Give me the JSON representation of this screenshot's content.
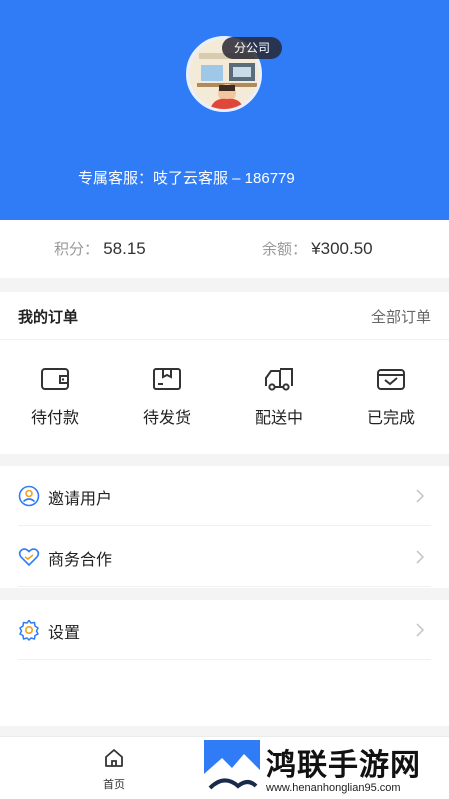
{
  "header": {
    "badge": "分公司",
    "service_text": "专属客服：吱了云客服 – 186779"
  },
  "stats": {
    "points_label": "积分：",
    "points_value": "58.15",
    "balance_label": "余额：",
    "balance_value": "¥300.50"
  },
  "orders": {
    "title": "我的订单",
    "all_label": "全部订单",
    "items": [
      {
        "label": "待付款",
        "icon": "wallet-icon"
      },
      {
        "label": "待发货",
        "icon": "box-icon"
      },
      {
        "label": "配送中",
        "icon": "truck-icon"
      },
      {
        "label": "已完成",
        "icon": "completed-box-icon"
      }
    ]
  },
  "menu": {
    "items": [
      {
        "label": "邀请用户",
        "icon": "user-circle-icon"
      },
      {
        "label": "商务合作",
        "icon": "heart-handshake-icon"
      },
      {
        "label": "设置",
        "icon": "gear-icon"
      }
    ]
  },
  "tabbar": {
    "home_label": "首页"
  },
  "watermark": {
    "title": "鸿联手游网",
    "url": "www.henanhonglian95.com"
  },
  "colors": {
    "brand_blue": "#2f7cf6",
    "icon_blue": "#2f7cf6",
    "icon_orange": "#f0a21a"
  }
}
